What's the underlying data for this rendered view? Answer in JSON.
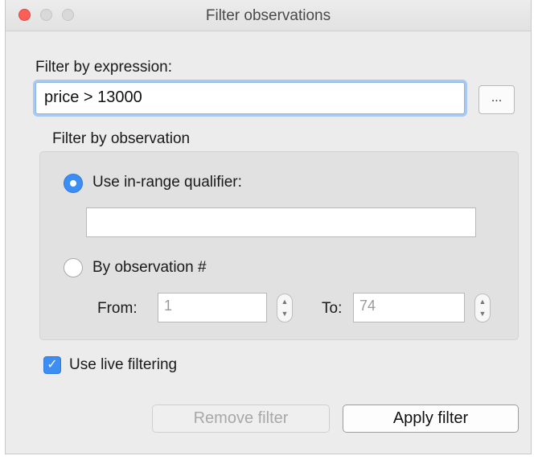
{
  "window": {
    "title": "Filter observations"
  },
  "expression": {
    "label": "Filter by expression:",
    "value": "price > 13000",
    "browse_label": "..."
  },
  "observation_group": {
    "label": "Filter by observation",
    "in_range": {
      "label": "Use in-range qualifier:",
      "selected": true,
      "value": ""
    },
    "by_number": {
      "label": "By observation #",
      "selected": false,
      "from_label": "From:",
      "from_value": "1",
      "to_label": "To:",
      "to_value": "74"
    }
  },
  "live_filtering": {
    "label": "Use live filtering",
    "checked": true,
    "check_glyph": "✓"
  },
  "buttons": {
    "remove": "Remove filter",
    "apply": "Apply filter"
  },
  "colors": {
    "accent": "#3c8ef4",
    "close": "#fc5f57"
  }
}
